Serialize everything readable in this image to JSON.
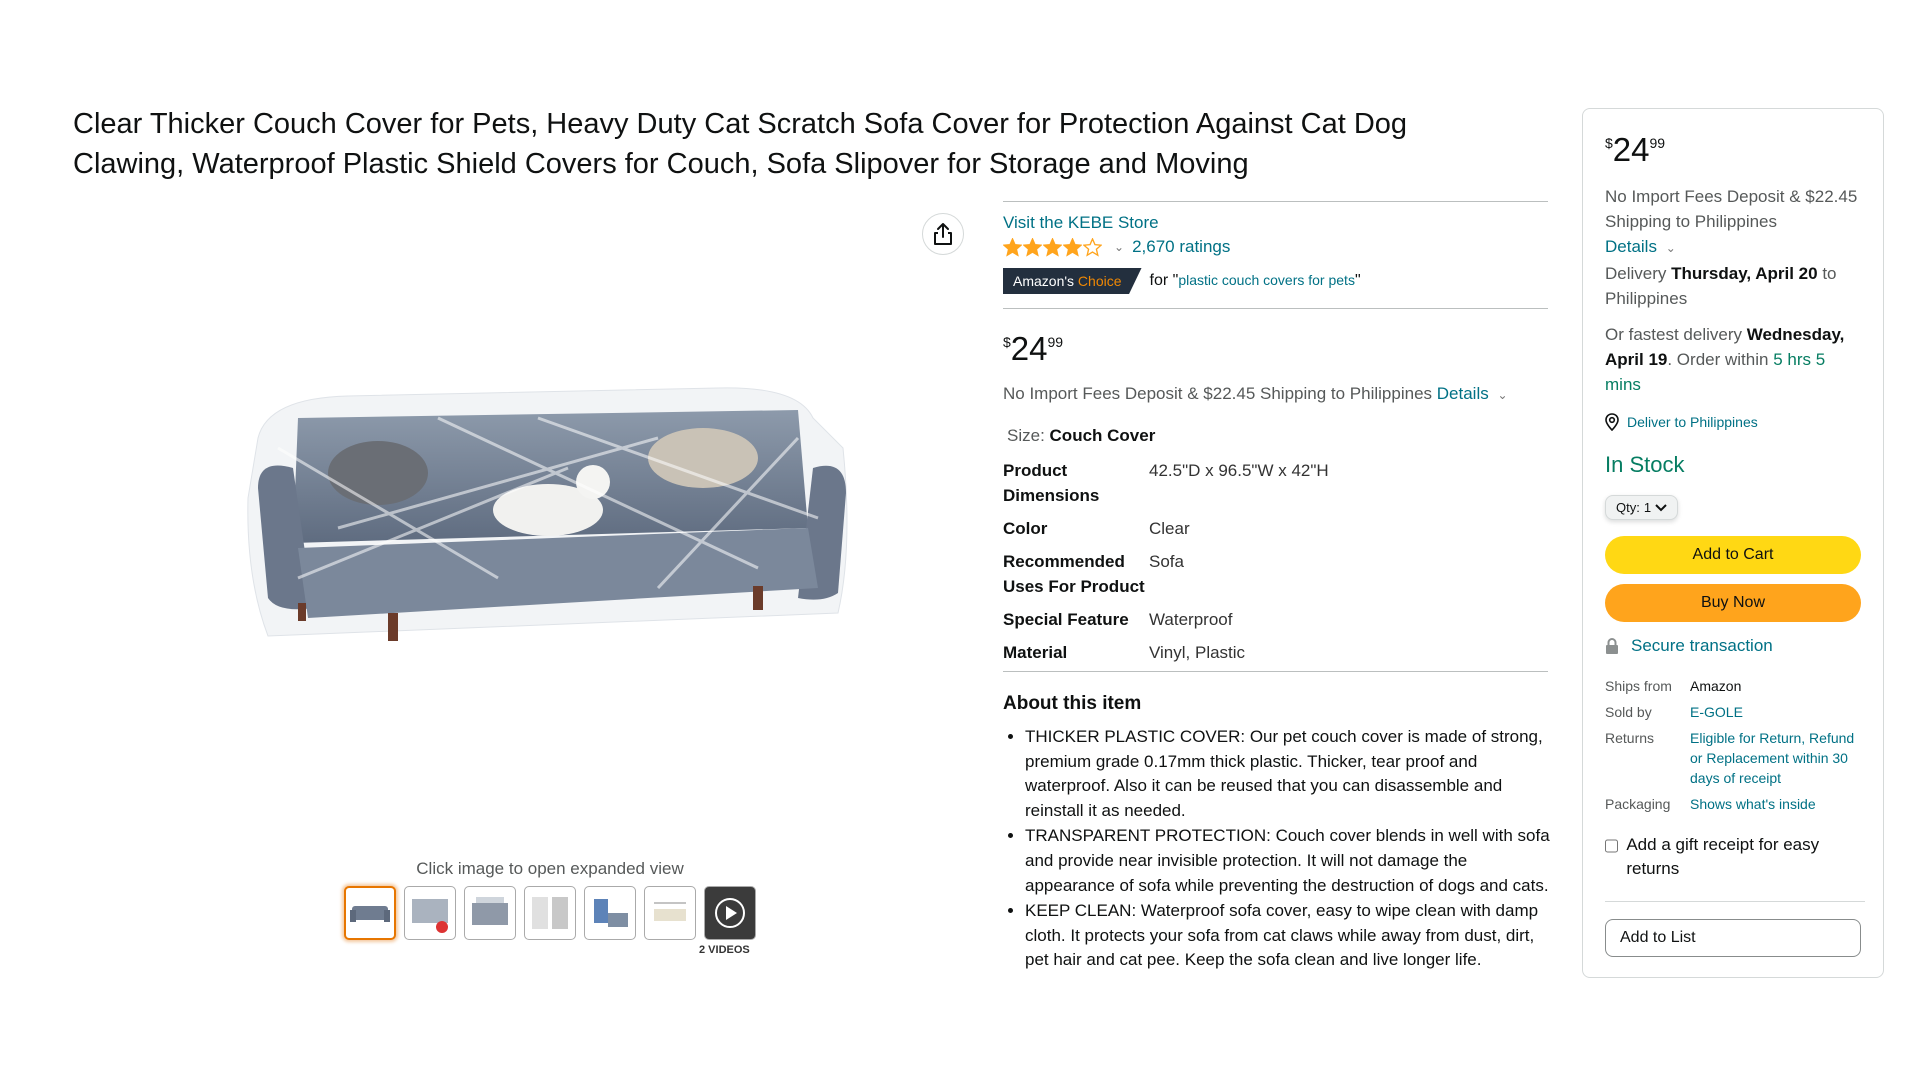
{
  "product": {
    "title": "Clear Thicker Couch Cover for Pets, Heavy Duty Cat Scratch Sofa Cover for Protection Against Cat Dog Clawing, Waterproof Plastic Shield Covers for Couch, Sofa Slipover for Storage and Moving",
    "store_link": "Visit the KEBE Store",
    "rating_value": 4.0,
    "ratings_count": "2,670 ratings",
    "choice_badge": {
      "prefix": "Amazon's",
      "highlight": "Choice"
    },
    "choice_for": "for \"",
    "choice_query": "plastic couch covers for pets",
    "choice_close": "\"",
    "price": {
      "symbol": "$",
      "whole": "24",
      "fraction": "99"
    },
    "shipping_text": "No Import Fees Deposit & $22.45 Shipping to Philippines",
    "details_link": "Details",
    "size_label": "Size:",
    "size_value": "Couch Cover",
    "specs": [
      {
        "key": "Product Dimensions",
        "value": "42.5\"D x 96.5\"W x 42\"H"
      },
      {
        "key": "Color",
        "value": "Clear"
      },
      {
        "key": "Recommended Uses For Product",
        "value": "Sofa"
      },
      {
        "key": "Special Feature",
        "value": "Waterproof"
      },
      {
        "key": "Material",
        "value": "Vinyl, Plastic"
      }
    ],
    "about_title": "About this item",
    "about_items": [
      "THICKER PLASTIC COVER: Our pet couch cover is made of strong, premium grade 0.17mm thick plastic. Thicker, tear proof and waterproof. Also it can be reused that you can disassemble and reinstall it as needed.",
      "TRANSPARENT PROTECTION: Couch cover blends in well with sofa and provide near invisible protection. It will not damage the appearance of sofa while preventing the destruction of dogs and cats.",
      "KEEP CLEAN: Waterproof sofa cover, easy to wipe clean with damp cloth. It protects your sofa from cat claws while away from dust, dirt, pet hair and cat pee. Keep the sofa clean and live longer life."
    ]
  },
  "gallery": {
    "caption": "Click image to open expanded view",
    "videos_label": "2 VIDEOS",
    "thumbnail_count": 7
  },
  "buybox": {
    "price": {
      "symbol": "$",
      "whole": "24",
      "fraction": "99"
    },
    "fees_text": "No Import Fees Deposit & $22.45 Shipping to Philippines",
    "details_link": "Details",
    "delivery_prefix": "Delivery",
    "delivery_date": "Thursday, April 20",
    "delivery_suffix": "to Philippines",
    "fastest_prefix": "Or fastest delivery",
    "fastest_date": "Wednesday, April 19",
    "order_within": ". Order within",
    "countdown": "5 hrs 5 mins",
    "deliver_to": "Deliver to Philippines",
    "stock": "In Stock",
    "qty_label": "Qty:",
    "qty_value": "1",
    "add_to_cart": "Add to Cart",
    "buy_now": "Buy Now",
    "secure": "Secure transaction",
    "meta": [
      {
        "key": "Ships from",
        "value": "Amazon",
        "is_link": false
      },
      {
        "key": "Sold by",
        "value": "E-GOLE",
        "is_link": true
      },
      {
        "key": "Returns",
        "value": "Eligible for Return, Refund or Replacement within 30 days of receipt",
        "is_link": true
      },
      {
        "key": "Packaging",
        "value": "Shows what's inside",
        "is_link": true
      }
    ],
    "gift_receipt": "Add a gift receipt for easy returns",
    "add_to_list": "Add to List"
  },
  "colors": {
    "link": "#007185",
    "star": "#ffa41c",
    "add_to_cart": "#ffd814",
    "buy_now": "#ffa41c",
    "in_stock": "#067d62",
    "choice_badge": "#232f3e"
  }
}
